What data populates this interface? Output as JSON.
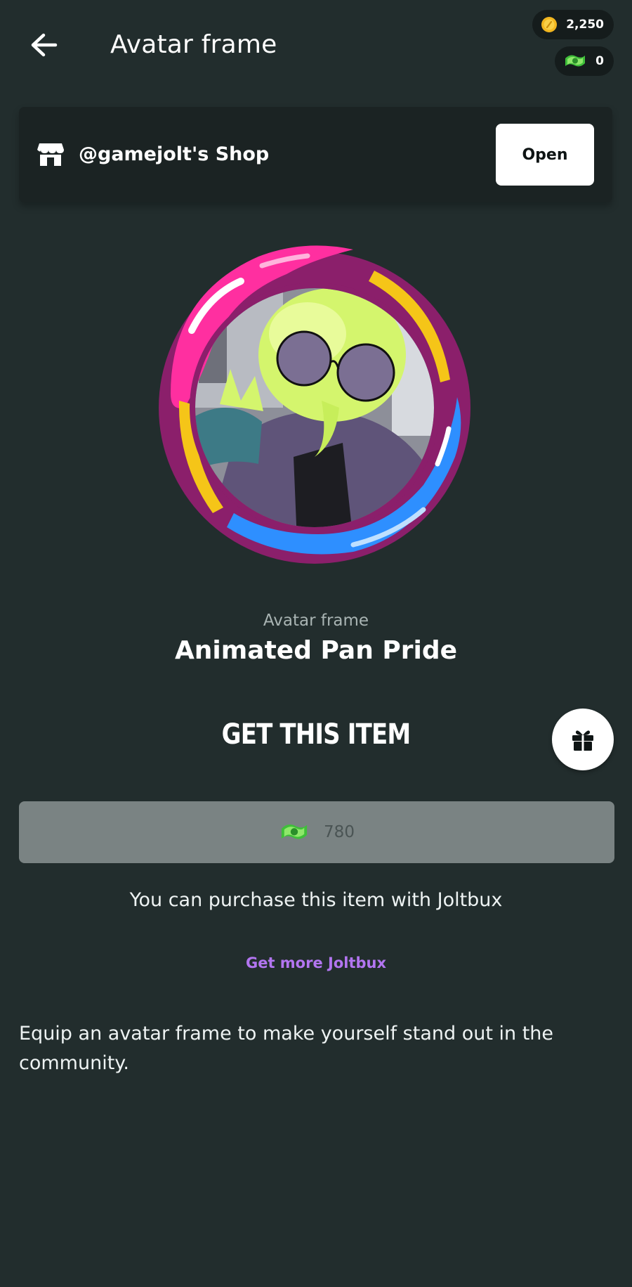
{
  "header": {
    "title": "Avatar frame",
    "coins": "2,250",
    "joltbux": "0"
  },
  "shop": {
    "name": "@gamejolt's Shop",
    "open_label": "Open"
  },
  "item": {
    "type": "Avatar frame",
    "name": "Animated Pan Pride"
  },
  "purchase": {
    "heading": "GET THIS ITEM",
    "price": "780",
    "note": "You can purchase this item with Joltbux",
    "get_more_label": "Get more Joltbux"
  },
  "description": "Equip an avatar frame to make yourself stand out in the community.",
  "icons": {
    "back": "arrow-left-icon",
    "coin": "coin-icon",
    "joltbux": "joltbux-icon",
    "shop": "shop-icon",
    "gift": "gift-icon"
  },
  "colors": {
    "background": "#222d2d",
    "card": "#1b2323",
    "link": "#b275f0",
    "price_button": "#7a8383",
    "frame_pink": "#ff2fa0",
    "frame_yellow": "#f5c518",
    "frame_blue": "#2e8fff",
    "frame_outline": "#8b1f6b"
  }
}
